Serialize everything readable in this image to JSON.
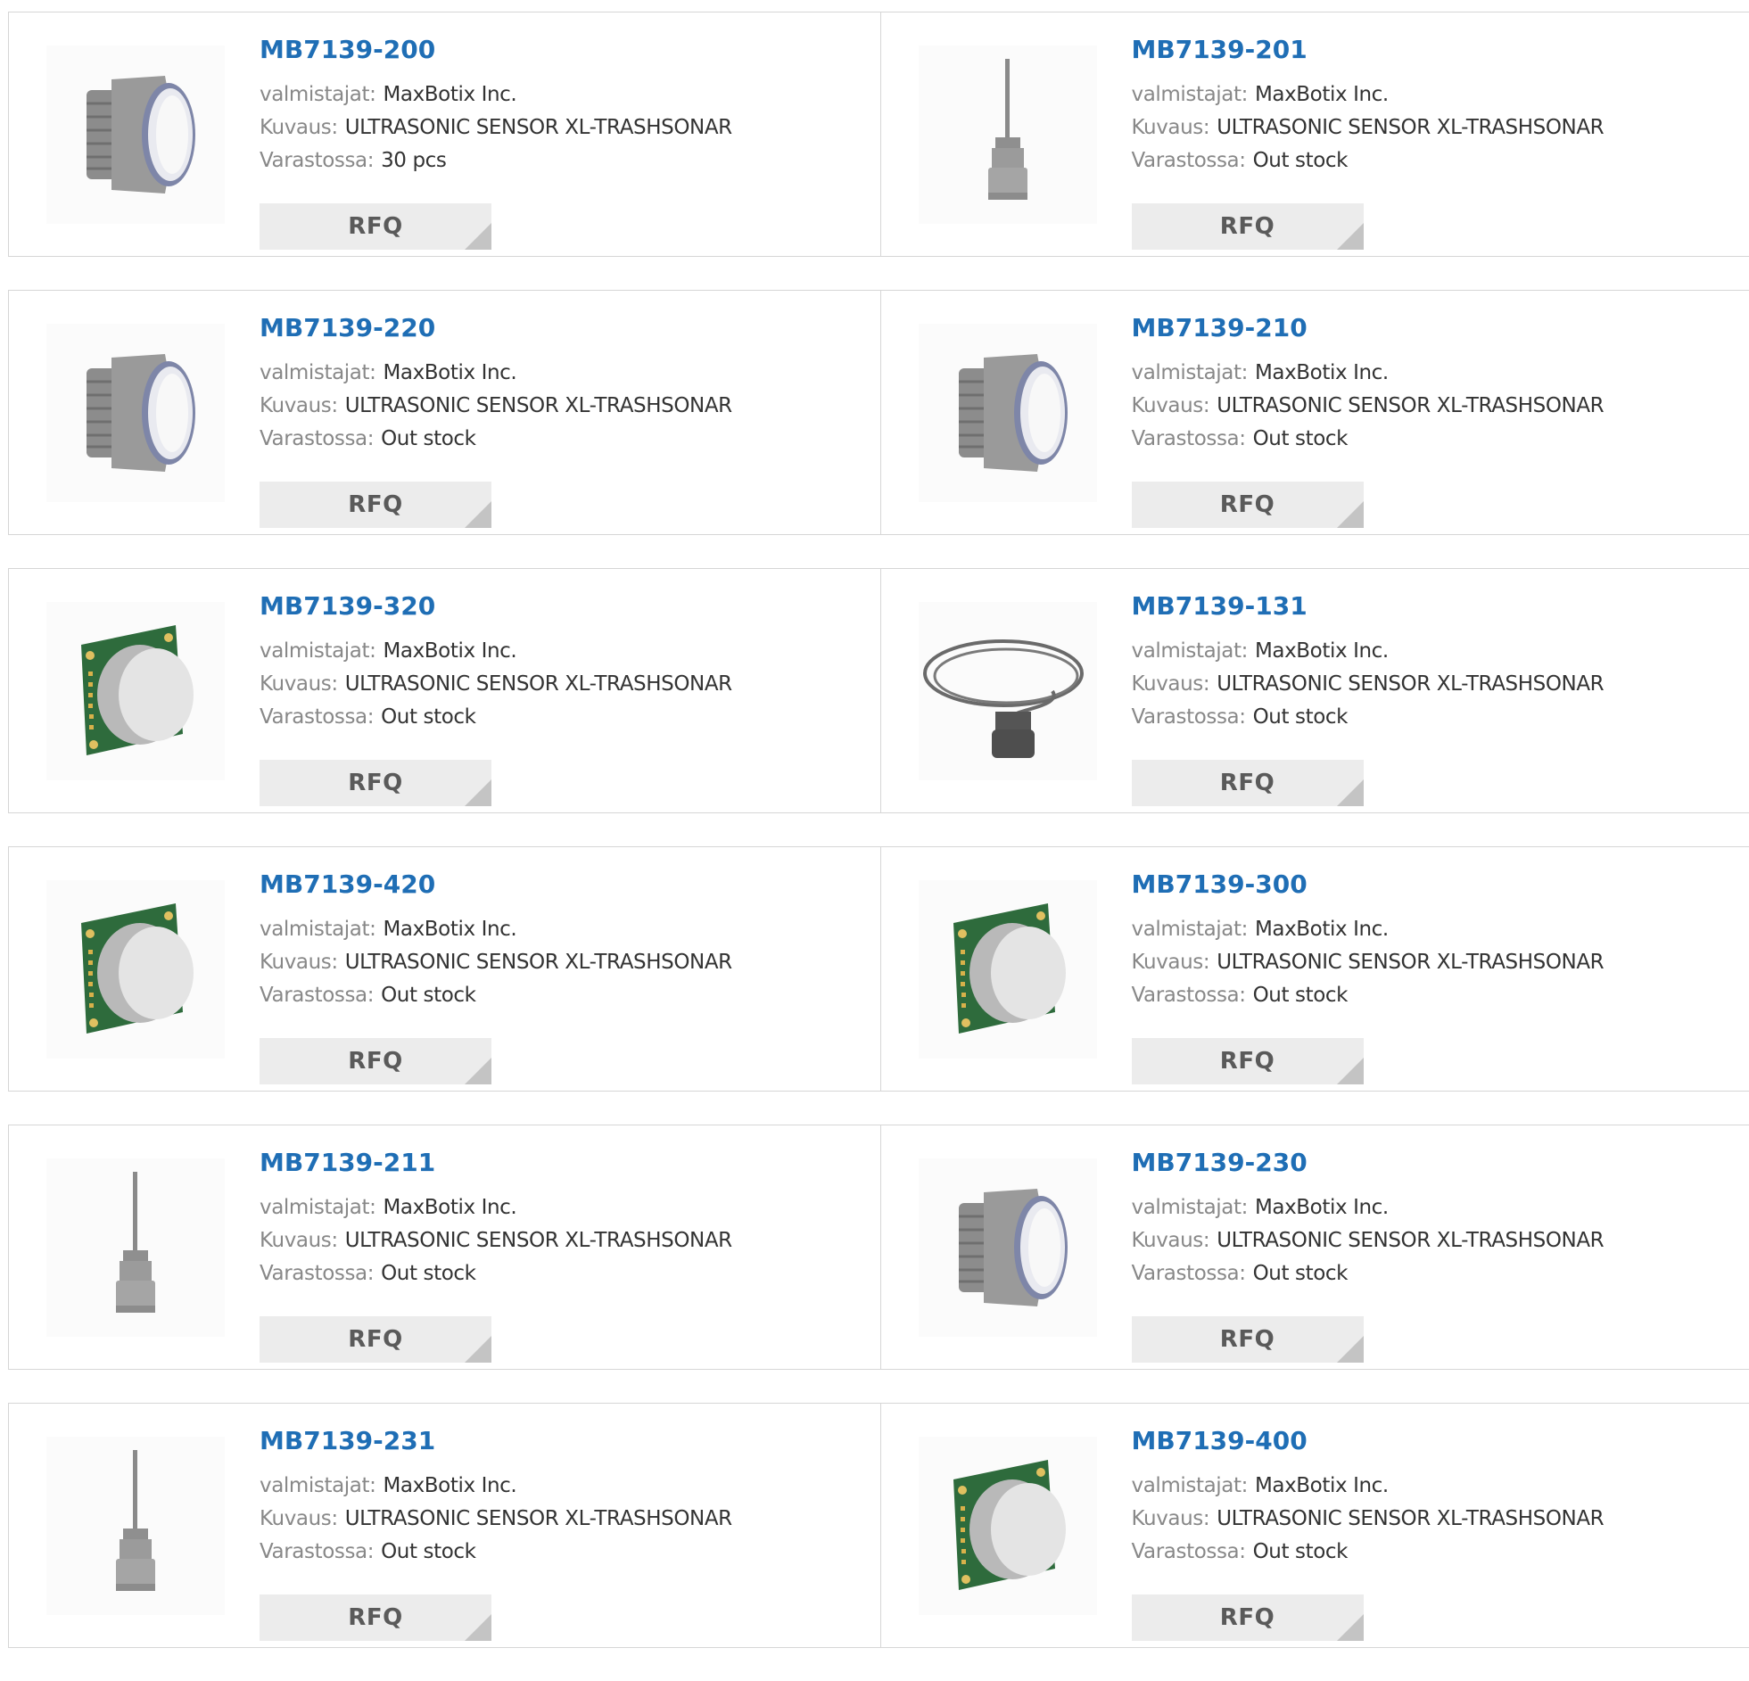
{
  "labels": {
    "manufacturer": "valmistajat:",
    "description": "Kuvaus:",
    "stock": "Varastossa:",
    "rfq": "RFQ"
  },
  "products": [
    {
      "part": "MB7139-200",
      "manufacturer": "MaxBotix Inc.",
      "description": "ULTRASONIC SENSOR XL-TRASHSONAR",
      "stock": "30 pcs",
      "image": "threaded-sensor"
    },
    {
      "part": "MB7139-201",
      "manufacturer": "MaxBotix Inc.",
      "description": "ULTRASONIC SENSOR XL-TRASHSONAR",
      "stock": "Out stock",
      "image": "cable-sensor"
    },
    {
      "part": "MB7139-220",
      "manufacturer": "MaxBotix Inc.",
      "description": "ULTRASONIC SENSOR XL-TRASHSONAR",
      "stock": "Out stock",
      "image": "threaded-sensor"
    },
    {
      "part": "MB7139-210",
      "manufacturer": "MaxBotix Inc.",
      "description": "ULTRASONIC SENSOR XL-TRASHSONAR",
      "stock": "Out stock",
      "image": "threaded-sensor"
    },
    {
      "part": "MB7139-320",
      "manufacturer": "MaxBotix Inc.",
      "description": "ULTRASONIC SENSOR XL-TRASHSONAR",
      "stock": "Out stock",
      "image": "pcb-sensor"
    },
    {
      "part": "MB7139-131",
      "manufacturer": "MaxBotix Inc.",
      "description": "ULTRASONIC SENSOR XL-TRASHSONAR",
      "stock": "Out stock",
      "image": "coiled-cable-sensor"
    },
    {
      "part": "MB7139-420",
      "manufacturer": "MaxBotix Inc.",
      "description": "ULTRASONIC SENSOR XL-TRASHSONAR",
      "stock": "Out stock",
      "image": "pcb-sensor"
    },
    {
      "part": "MB7139-300",
      "manufacturer": "MaxBotix Inc.",
      "description": "ULTRASONIC SENSOR XL-TRASHSONAR",
      "stock": "Out stock",
      "image": "pcb-sensor"
    },
    {
      "part": "MB7139-211",
      "manufacturer": "MaxBotix Inc.",
      "description": "ULTRASONIC SENSOR XL-TRASHSONAR",
      "stock": "Out stock",
      "image": "cable-sensor"
    },
    {
      "part": "MB7139-230",
      "manufacturer": "MaxBotix Inc.",
      "description": "ULTRASONIC SENSOR XL-TRASHSONAR",
      "stock": "Out stock",
      "image": "threaded-sensor"
    },
    {
      "part": "MB7139-231",
      "manufacturer": "MaxBotix Inc.",
      "description": "ULTRASONIC SENSOR XL-TRASHSONAR",
      "stock": "Out stock",
      "image": "cable-sensor"
    },
    {
      "part": "MB7139-400",
      "manufacturer": "MaxBotix Inc.",
      "description": "ULTRASONIC SENSOR XL-TRASHSONAR",
      "stock": "Out stock",
      "image": "pcb-sensor"
    }
  ]
}
